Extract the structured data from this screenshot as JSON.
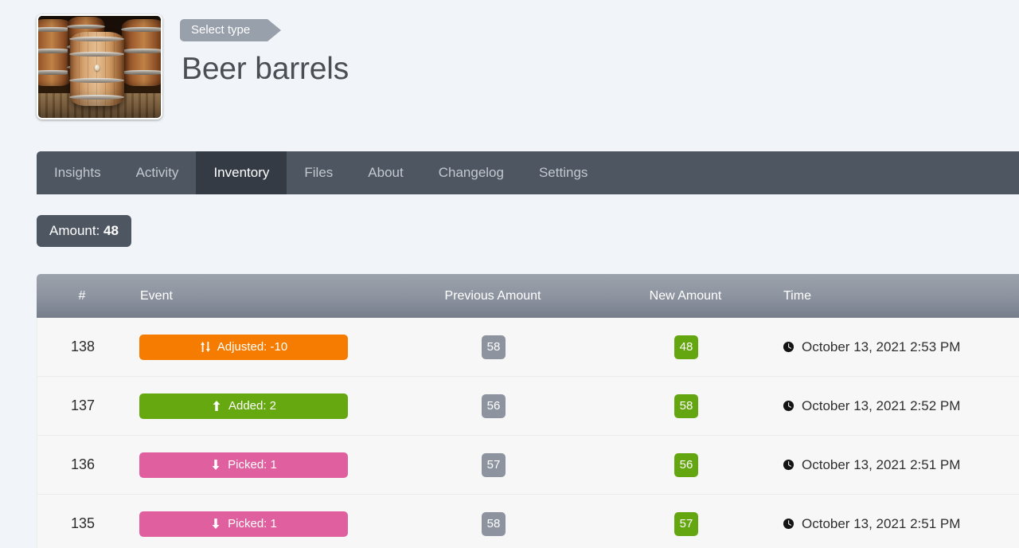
{
  "header": {
    "ribbon_label": "Select type",
    "title": "Beer barrels",
    "thumbnail_alt": "beer-barrels-photo"
  },
  "tabs": [
    {
      "label": "Insights",
      "active": false
    },
    {
      "label": "Activity",
      "active": false
    },
    {
      "label": "Inventory",
      "active": true
    },
    {
      "label": "Files",
      "active": false
    },
    {
      "label": "About",
      "active": false
    },
    {
      "label": "Changelog",
      "active": false
    },
    {
      "label": "Settings",
      "active": false
    }
  ],
  "amount": {
    "label": "Amount: ",
    "value": "48"
  },
  "table": {
    "columns": {
      "num": "#",
      "event": "Event",
      "previous": "Previous Amount",
      "new": "New Amount",
      "time": "Time"
    },
    "rows": [
      {
        "num": "138",
        "event_type": "adjusted",
        "event_icon": "adjust-arrows-icon",
        "event_label": "Adjusted: -10",
        "previous": "58",
        "new": "48",
        "time_icon": "clock-icon",
        "time": "October 13, 2021 2:53 PM"
      },
      {
        "num": "137",
        "event_type": "added",
        "event_icon": "arrow-up-icon",
        "event_label": "Added: 2",
        "previous": "56",
        "new": "58",
        "time_icon": "clock-icon",
        "time": "October 13, 2021 2:52 PM"
      },
      {
        "num": "136",
        "event_type": "picked",
        "event_icon": "arrow-down-icon",
        "event_label": "Picked: 1",
        "previous": "57",
        "new": "56",
        "time_icon": "clock-icon",
        "time": "October 13, 2021 2:51 PM"
      },
      {
        "num": "135",
        "event_type": "picked",
        "event_icon": "arrow-down-icon",
        "event_label": "Picked: 1",
        "previous": "58",
        "new": "57",
        "time_icon": "clock-icon",
        "time": "October 13, 2021 2:51 PM"
      }
    ]
  },
  "colors": {
    "page_bg": "#f1f4f8",
    "tabbar": "#4e5662",
    "tab_active": "#343b45",
    "thead": "#8d94a0",
    "adjusted": "#f57c00",
    "added": "#66a80f",
    "picked": "#e0609f",
    "pill_prev": "#8d94a0",
    "pill_new": "#63a60f"
  }
}
